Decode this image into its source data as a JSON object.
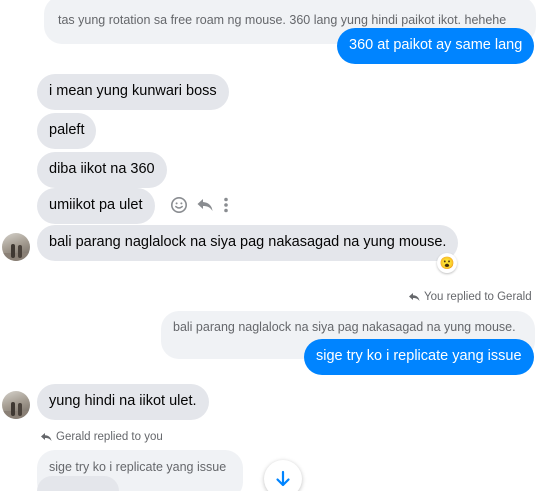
{
  "colors": {
    "outgoing_bubble": "#0084ff",
    "incoming_bubble": "#e4e6eb",
    "quoted_bubble": "#f0f2f5",
    "meta_text": "#65676b"
  },
  "messages": {
    "quote_top": "tas yung rotation sa free roam ng mouse. 360 lang yung hindi paikot ikot. hehehe",
    "out_1": "360 at paikot ay same lang",
    "in_1": "i mean yung kunwari boss",
    "in_2": "paleft",
    "in_3": "diba iikot na 360",
    "in_4": "umiikot pa ulet",
    "in_5": "bali parang naglalock na siya pag nakasagad na yung mouse.",
    "reaction_1": "😮",
    "you_replied_label": "You replied to Gerald",
    "quote_mid": "bali parang naglalock na siya pag nakasagad na yung mouse.",
    "out_2": "sige try ko i replicate yang issue",
    "in_6": "yung hindi na iikot ulet.",
    "gerald_replied_label": "Gerald replied to you",
    "quote_bottom": "sige try ko i replicate yang issue"
  },
  "icons": {
    "react": "smiley-icon",
    "reply": "reply-arrow-icon",
    "more": "more-vertical-icon",
    "scroll": "arrow-down-icon"
  }
}
